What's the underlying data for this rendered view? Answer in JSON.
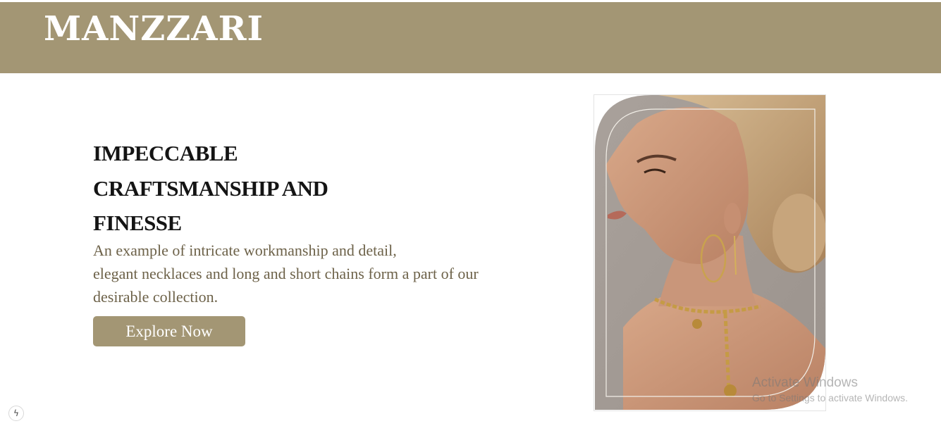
{
  "header": {
    "logo": "MANZZARI"
  },
  "hero": {
    "title_lines": [
      "IMPECCABLE",
      "CRAFTSMANSHIP AND",
      "FINESSE"
    ],
    "description_lines": [
      "An example of intricate workmanship and detail,",
      "elegant necklaces and long and short chains form a part of our",
      "desirable collection."
    ],
    "cta_label": "Explore Now"
  },
  "watermark": {
    "title": "Activate Windows",
    "subtitle": "Go to Settings to activate Windows."
  },
  "colors": {
    "brand": "#a39674",
    "heading": "#141414",
    "body_text": "#6d6249"
  },
  "icons": {
    "corner": "lightning-icon",
    "photo": "model-jewelry-photo"
  }
}
